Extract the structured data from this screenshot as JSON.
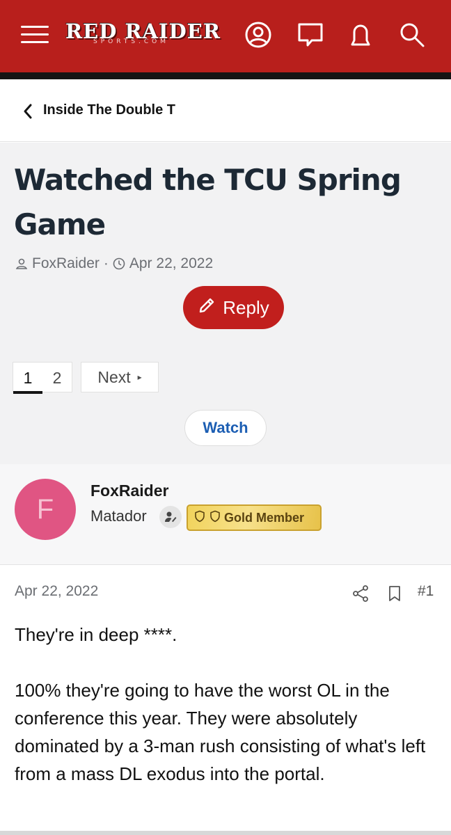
{
  "header": {
    "logo_main": "RED RAIDER",
    "logo_sub": "SPORTS.COM",
    "brand_color": "#b81f1c",
    "icons": [
      "menu-icon",
      "account-icon",
      "chat-icon",
      "alerts-icon",
      "search-icon"
    ]
  },
  "breadcrumb": {
    "label": "Inside The Double T"
  },
  "thread": {
    "title": "Watched the TCU Spring Game",
    "author": "FoxRaider",
    "separator": "·",
    "date": "Apr 22, 2022",
    "reply_label": "Reply",
    "pages": [
      "1",
      "2"
    ],
    "current_page": "1",
    "next_label": "Next",
    "watch_label": "Watch"
  },
  "post": {
    "avatar_letter": "F",
    "avatar_color": "#e05583",
    "username": "FoxRaider",
    "user_title": "Matador",
    "badge": "Gold Member",
    "date": "Apr 22, 2022",
    "number": "#1",
    "paragraphs": [
      "They're in deep ****.",
      "100% they're going to have the worst OL in the conference this year. They were absolutely dominated by a 3-man rush consisting of what's left from a mass DL exodus into the portal."
    ]
  }
}
